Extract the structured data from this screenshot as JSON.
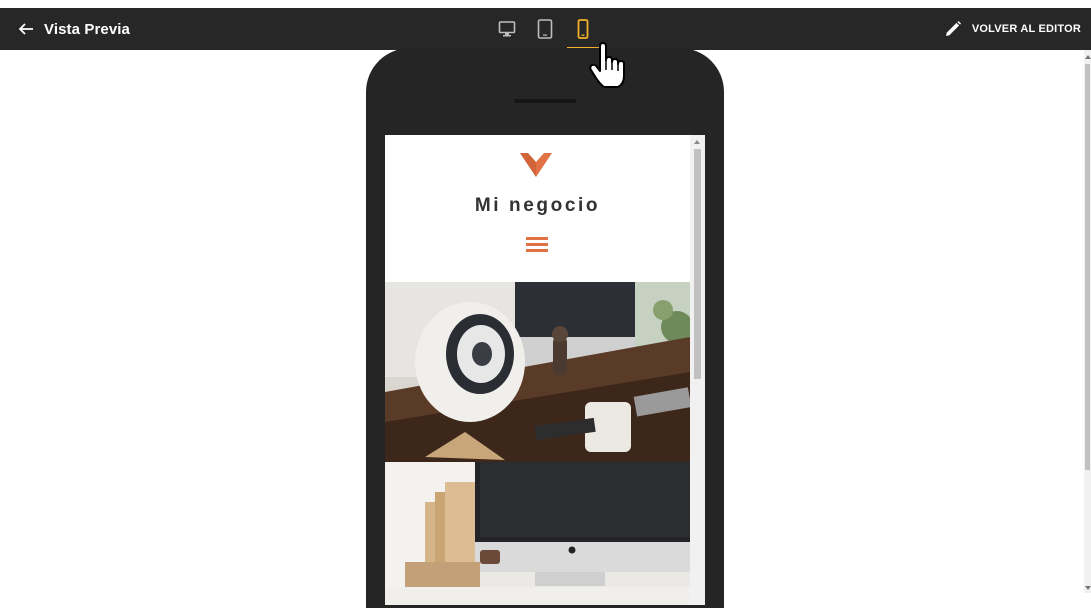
{
  "topbar": {
    "back_label": "Vista Previa",
    "editor_label": "VOLVER AL EDITOR",
    "devices": [
      {
        "icon": "desktop-icon",
        "active": false
      },
      {
        "icon": "tablet-icon",
        "active": false
      },
      {
        "icon": "mobile-icon",
        "active": true
      }
    ]
  },
  "site": {
    "title": "Mi negocio"
  },
  "colors": {
    "topbar_bg": "#272727",
    "active_accent": "#f1b12a",
    "brand": "#e07246",
    "phone_body": "#252525"
  }
}
